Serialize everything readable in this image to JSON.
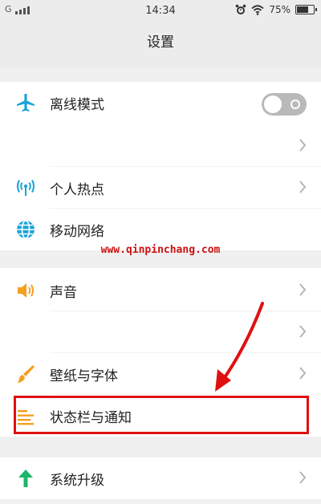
{
  "status_bar": {
    "carrier": "G",
    "time": "14:34",
    "battery_percent": "75%",
    "battery_level": 0.75
  },
  "header": {
    "title": "设置"
  },
  "settings": {
    "airplane": {
      "label": "离线模式",
      "icon": "airplane-icon",
      "toggle_on": false
    },
    "hotspot": {
      "label": "个人热点",
      "icon": "hotspot-icon"
    },
    "mobile_network": {
      "label": "移动网络",
      "icon": "globe-icon"
    },
    "sound": {
      "label": "声音",
      "icon": "speaker-icon"
    },
    "wallpaper_font": {
      "label": "壁纸与字体",
      "icon": "brush-icon"
    },
    "statusbar_notifications": {
      "label": "状态栏与通知",
      "icon": "statusbar-icon"
    },
    "system_update": {
      "label": "系统升级",
      "icon": "up-arrow-icon"
    }
  },
  "watermark": "www.qinpinchang.com",
  "colors": {
    "accent": "#1aa3d9",
    "toggle_off": "#b9b9b9",
    "annotation_red": "#e01010",
    "sound_icon": "#f3a021",
    "update_icon": "#1db66a"
  }
}
